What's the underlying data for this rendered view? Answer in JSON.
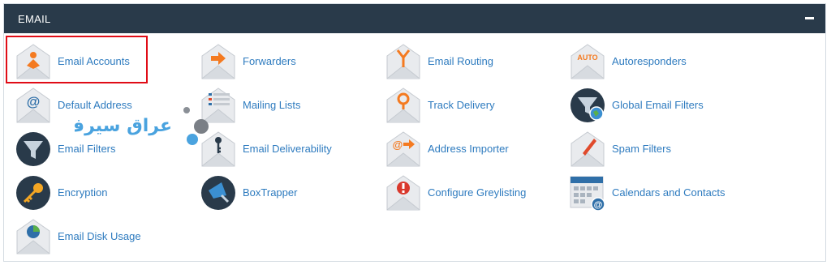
{
  "panel": {
    "title": "EMAIL",
    "collapse_icon": "minus-icon"
  },
  "items": [
    {
      "label": "Email Accounts",
      "icon": "user-envelope-icon"
    },
    {
      "label": "Forwarders",
      "icon": "arrow-envelope-icon"
    },
    {
      "label": "Email Routing",
      "icon": "routing-envelope-icon"
    },
    {
      "label": "Autoresponders",
      "icon": "auto-envelope-icon"
    },
    {
      "label": "Default Address",
      "icon": "at-envelope-icon"
    },
    {
      "label": "Mailing Lists",
      "icon": "list-envelope-icon"
    },
    {
      "label": "Track Delivery",
      "icon": "pin-envelope-icon"
    },
    {
      "label": "Global Email Filters",
      "icon": "globe-funnel-icon"
    },
    {
      "label": "Email Filters",
      "icon": "funnel-icon"
    },
    {
      "label": "Email Deliverability",
      "icon": "key-envelope-icon"
    },
    {
      "label": "Address Importer",
      "icon": "at-arrow-envelope-icon"
    },
    {
      "label": "Spam Filters",
      "icon": "pencil-envelope-icon"
    },
    {
      "label": "Encryption",
      "icon": "key-icon"
    },
    {
      "label": "BoxTrapper",
      "icon": "trap-icon"
    },
    {
      "label": "Configure Greylisting",
      "icon": "alert-envelope-icon"
    },
    {
      "label": "Calendars and Contacts",
      "icon": "calendar-icon"
    },
    {
      "label": "Email Disk Usage",
      "icon": "pie-envelope-icon"
    }
  ],
  "watermark": {
    "text": "عراق سيرف"
  },
  "colors": {
    "header_bg": "#293a4a",
    "link": "#2e7bbf",
    "accent_orange": "#f47a20",
    "highlight": "#e00c16"
  }
}
